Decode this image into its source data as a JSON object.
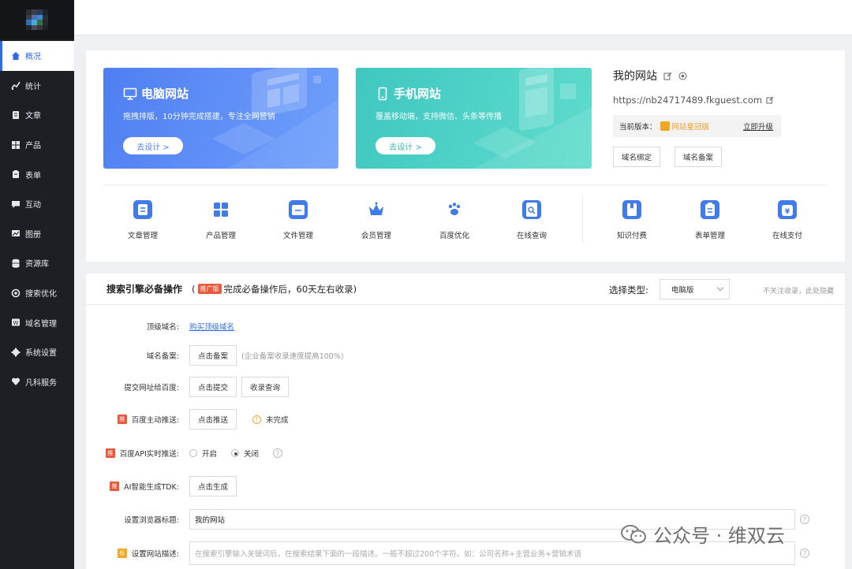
{
  "sidebar": {
    "items": [
      {
        "label": "概况",
        "icon": "home-icon"
      },
      {
        "label": "统计",
        "icon": "chart-icon"
      },
      {
        "label": "文章",
        "icon": "article-icon"
      },
      {
        "label": "产品",
        "icon": "product-icon"
      },
      {
        "label": "表单",
        "icon": "form-icon"
      },
      {
        "label": "互动",
        "icon": "chat-icon"
      },
      {
        "label": "图册",
        "icon": "image-icon"
      },
      {
        "label": "资源库",
        "icon": "database-icon"
      },
      {
        "label": "搜索优化",
        "icon": "seo-icon"
      },
      {
        "label": "域名管理",
        "icon": "domain-icon"
      },
      {
        "label": "系统设置",
        "icon": "gear-icon"
      },
      {
        "label": "凡科服务",
        "icon": "heart-icon"
      }
    ]
  },
  "banners": {
    "pc": {
      "title": "电脑网站",
      "subtitle": "拖拽排版，10分钟完成搭建，专注全网营销",
      "button": "去设计 >"
    },
    "mobile": {
      "title": "手机网站",
      "subtitle": "覆盖移动端，支持微信、头条等传播",
      "button": "去设计 >"
    }
  },
  "site": {
    "name": "我的网站",
    "url": "https://nb24717489.fkguest.com",
    "version_label": "当前版本：",
    "version_name": "网站皇冠版",
    "upgrade": "立即升级",
    "btn_bind": "域名绑定",
    "btn_record": "域名备案"
  },
  "tools": [
    {
      "label": "文章管理",
      "icon": "article-manage-icon"
    },
    {
      "label": "产品管理",
      "icon": "product-manage-icon"
    },
    {
      "label": "文件管理",
      "icon": "folder-icon"
    },
    {
      "label": "会员管理",
      "icon": "crown-icon"
    },
    {
      "label": "百度优化",
      "icon": "paw-icon"
    },
    {
      "label": "在线查询",
      "icon": "search-doc-icon"
    },
    {
      "label": "知识付费",
      "icon": "book-icon"
    },
    {
      "label": "表单管理",
      "icon": "clipboard-icon"
    },
    {
      "label": "在线支付",
      "icon": "payment-icon"
    }
  ],
  "seo": {
    "title": "搜索引擎必备操作",
    "sub_open": "(",
    "tag": "推广版",
    "sub_text": "完成必备操作后，60天左右收录)",
    "select_label": "选择类型:",
    "select_value": "电脑版",
    "hint": "不关注收录，此处隐藏",
    "rows": {
      "top_domain": {
        "label": "顶级域名:",
        "link": "购买顶级域名"
      },
      "record": {
        "label": "域名备案:",
        "button": "点击备案",
        "note": "(企业备案收录速度提高100%)"
      },
      "submit": {
        "label": "提交网址给百度:",
        "button1": "点击提交",
        "button2": "收录查询"
      },
      "push": {
        "tag": "推",
        "label": "百度主动推送:",
        "button": "点击推送",
        "status_icon": "!",
        "status": "未完成"
      },
      "api": {
        "tag": "推",
        "label": "百度API实时推送:",
        "on": "开启",
        "off": "关闭",
        "help": "?"
      },
      "tdk": {
        "tag": "推",
        "label": "AI智能生成TDK:",
        "button": "点击生成"
      },
      "browser_title": {
        "label": "设置浏览器标题:",
        "value": "我的网站",
        "help": "?"
      },
      "desc": {
        "tag": "标",
        "label": "设置网站描述:",
        "placeholder": "在搜索引擎输入关键词后，在搜索结果下面的一段描述。一般不超过200个字符。如：公司名称+主营业务+营销术语",
        "help": "?"
      }
    }
  },
  "watermark": "公众号 · 维双云",
  "colors": {
    "accent": "#2f6ae6",
    "sidebar_bg": "#1d1f24",
    "tag_red": "#e95a3c",
    "banner_blue": "#4f7ef2",
    "banner_teal": "#3fc7c0"
  }
}
